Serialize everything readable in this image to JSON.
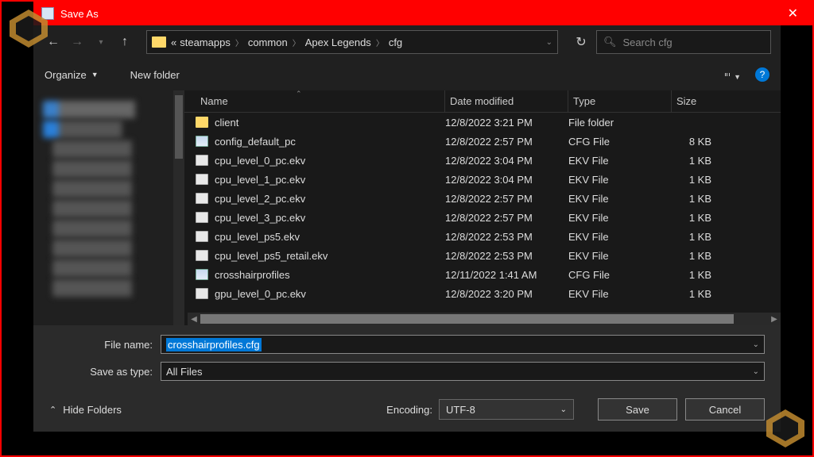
{
  "title": "Save As",
  "breadcrumb": {
    "prefix": "«",
    "segments": [
      "steamapps",
      "common",
      "Apex Legends",
      "cfg"
    ]
  },
  "search": {
    "placeholder": "Search cfg"
  },
  "toolbar": {
    "organize": "Organize",
    "newfolder": "New folder"
  },
  "columns": {
    "name": "Name",
    "date": "Date modified",
    "type": "Type",
    "size": "Size"
  },
  "files": [
    {
      "icon": "folder",
      "name": "client",
      "date": "12/8/2022 3:21 PM",
      "type": "File folder",
      "size": ""
    },
    {
      "icon": "cfg",
      "name": "config_default_pc",
      "date": "12/8/2022 2:57 PM",
      "type": "CFG File",
      "size": "8 KB"
    },
    {
      "icon": "file",
      "name": "cpu_level_0_pc.ekv",
      "date": "12/8/2022 3:04 PM",
      "type": "EKV File",
      "size": "1 KB"
    },
    {
      "icon": "file",
      "name": "cpu_level_1_pc.ekv",
      "date": "12/8/2022 3:04 PM",
      "type": "EKV File",
      "size": "1 KB"
    },
    {
      "icon": "file",
      "name": "cpu_level_2_pc.ekv",
      "date": "12/8/2022 2:57 PM",
      "type": "EKV File",
      "size": "1 KB"
    },
    {
      "icon": "file",
      "name": "cpu_level_3_pc.ekv",
      "date": "12/8/2022 2:57 PM",
      "type": "EKV File",
      "size": "1 KB"
    },
    {
      "icon": "file",
      "name": "cpu_level_ps5.ekv",
      "date": "12/8/2022 2:53 PM",
      "type": "EKV File",
      "size": "1 KB"
    },
    {
      "icon": "file",
      "name": "cpu_level_ps5_retail.ekv",
      "date": "12/8/2022 2:53 PM",
      "type": "EKV File",
      "size": "1 KB"
    },
    {
      "icon": "cfg",
      "name": "crosshairprofiles",
      "date": "12/11/2022 1:41 AM",
      "type": "CFG File",
      "size": "1 KB"
    },
    {
      "icon": "file",
      "name": "gpu_level_0_pc.ekv",
      "date": "12/8/2022 3:20 PM",
      "type": "EKV File",
      "size": "1 KB"
    }
  ],
  "form": {
    "filename_label": "File name:",
    "filename_value": "crosshairprofiles.cfg",
    "saveastype_label": "Save as type:",
    "saveastype_value": "All Files",
    "encoding_label": "Encoding:",
    "encoding_value": "UTF-8",
    "hide_folders": "Hide Folders",
    "save": "Save",
    "cancel": "Cancel"
  }
}
